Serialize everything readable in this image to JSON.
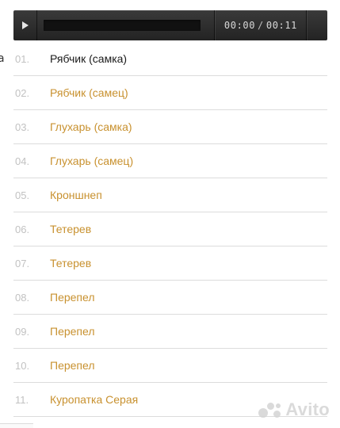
{
  "player": {
    "current_time": "00:00",
    "separator": "/",
    "total_time": "00:11",
    "progress_fraction": 0
  },
  "left_edge": {
    "char": "а"
  },
  "tracks": [
    {
      "num": "01.",
      "title": "Рябчик (самка)",
      "active": true
    },
    {
      "num": "02.",
      "title": "Рябчик (самец)",
      "active": false
    },
    {
      "num": "03.",
      "title": "Глухарь (самка)",
      "active": false
    },
    {
      "num": "04.",
      "title": "Глухарь (самец)",
      "active": false
    },
    {
      "num": "05.",
      "title": "Кроншнеп",
      "active": false
    },
    {
      "num": "06.",
      "title": "Тетерев",
      "active": false
    },
    {
      "num": "07.",
      "title": "Тетерев",
      "active": false
    },
    {
      "num": "08.",
      "title": "Перепел",
      "active": false
    },
    {
      "num": "09.",
      "title": "Перепел",
      "active": false
    },
    {
      "num": "10.",
      "title": "Перепел",
      "active": false
    },
    {
      "num": "11.",
      "title": "Куропатка Серая",
      "active": false
    }
  ],
  "watermark": {
    "text": "Avito"
  },
  "colors": {
    "accent": "#c8912f",
    "active_text": "#1a1a1a",
    "number": "#c2c2c2",
    "player_bg": "#2b2b2b",
    "divider": "#dcdcdc"
  }
}
